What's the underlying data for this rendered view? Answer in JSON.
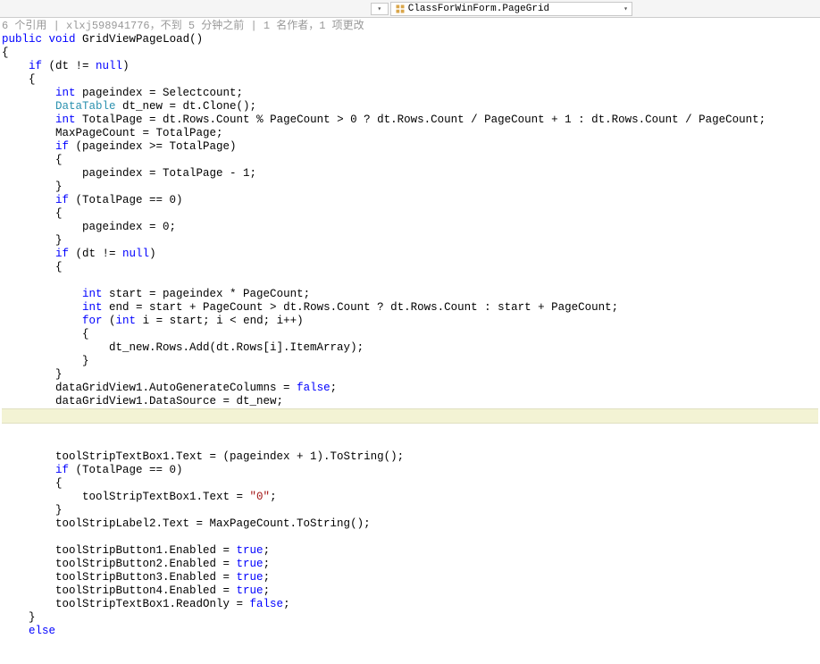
{
  "toolbar": {
    "class_path": "ClassForWinForm.PageGrid"
  },
  "meta": {
    "refs_prefix": "6 个引用",
    "author": "xlxj598941776，不到 5 分钟之前",
    "authors_suffix": "1 名作者，1 项更改"
  },
  "code": {
    "sig_prefix": "public",
    "sig_void": "void",
    "sig_name": " GridViewPageLoad()",
    "l2": "{",
    "l3_pre": "    ",
    "l3_if": "if",
    "l3_post": " (dt != ",
    "l3_null": "null",
    "l3_end": ")",
    "l4": "    {",
    "l5_pre": "        ",
    "l5_int": "int",
    "l5_post": " pageindex = Selectcount;",
    "l6_pre": "        ",
    "l6_type": "DataTable",
    "l6_post": " dt_new = dt.Clone();",
    "l7_pre": "        ",
    "l7_int": "int",
    "l7_post": " TotalPage = dt.Rows.Count % PageCount > 0 ? dt.Rows.Count / PageCount + 1 : dt.Rows.Count / PageCount;",
    "l8": "        MaxPageCount = TotalPage;",
    "l9_pre": "        ",
    "l9_if": "if",
    "l9_post": " (pageindex >= TotalPage)",
    "l10": "        {",
    "l11": "            pageindex = TotalPage - 1;",
    "l12": "        }",
    "l13_pre": "        ",
    "l13_if": "if",
    "l13_post": " (TotalPage == 0)",
    "l14": "        {",
    "l15": "            pageindex = 0;",
    "l16": "        }",
    "l17_pre": "        ",
    "l17_if": "if",
    "l17_post": " (dt != ",
    "l17_null": "null",
    "l17_end": ")",
    "l18": "        {",
    "l19": "",
    "l20_pre": "            ",
    "l20_int": "int",
    "l20_post": " start = pageindex * PageCount;",
    "l21_pre": "            ",
    "l21_int": "int",
    "l21_post": " end = start + PageCount > dt.Rows.Count ? dt.Rows.Count : start + PageCount;",
    "l22_pre": "            ",
    "l22_for": "for",
    "l22_mid": " (",
    "l22_int": "int",
    "l22_post": " i = start; i < end; i++)",
    "l23": "            {",
    "l24": "                dt_new.Rows.Add(dt.Rows[i].ItemArray);",
    "l25": "            }",
    "l26": "        }",
    "l27_pre": "        dataGridView1.AutoGenerateColumns = ",
    "l27_false": "false",
    "l27_end": ";",
    "l28": "        dataGridView1.DataSource = dt_new;",
    "l29": "        ",
    "l30": "",
    "l31": "        toolStripTextBox1.Text = (pageindex + 1).ToString();",
    "l32_pre": "        ",
    "l32_if": "if",
    "l32_post": " (TotalPage == 0)",
    "l33": "        {",
    "l34_pre": "            toolStripTextBox1.Text = ",
    "l34_str": "\"0\"",
    "l34_end": ";",
    "l35": "        }",
    "l36": "        toolStripLabel2.Text = MaxPageCount.ToString();",
    "l37": "",
    "l38_pre": "        toolStripButton1.Enabled = ",
    "l38_true": "true",
    "l38_end": ";",
    "l39_pre": "        toolStripButton2.Enabled = ",
    "l39_true": "true",
    "l39_end": ";",
    "l40_pre": "        toolStripButton3.Enabled = ",
    "l40_true": "true",
    "l40_end": ";",
    "l41_pre": "        toolStripButton4.Enabled = ",
    "l41_true": "true",
    "l41_end": ";",
    "l42_pre": "        toolStripTextBox1.ReadOnly = ",
    "l42_false": "false",
    "l42_end": ";",
    "l43": "    }",
    "l44_pre": "    ",
    "l44_else": "else"
  }
}
